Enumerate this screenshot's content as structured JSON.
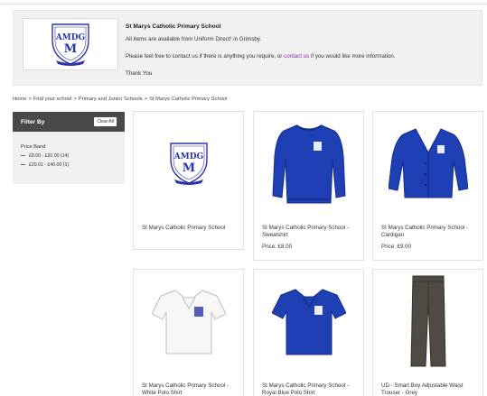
{
  "banner": {
    "title": "St Marys Catholic Primary School",
    "line1": "All items are available from Uniform Direct¹ in Grimsby.",
    "line2_pre": "Please feel free to contact us if there is anything you require, or",
    "line2_link": "contact us",
    "line2_post": "if you would like more information.",
    "thanks": "Thank You"
  },
  "breadcrumb": {
    "items": [
      "Home",
      "Find your school",
      "Primary and Junior Schools",
      "St Marys Catholic Primary School"
    ],
    "separator": ">"
  },
  "filter": {
    "title": "Filter By",
    "clear_label": "Clear All",
    "group_label": "Price Band",
    "options": [
      "£8.00 - £20.00 (14)",
      "£20.01 - £40.00 (1)"
    ]
  },
  "logo": {
    "text": "AMDG",
    "initial": "M"
  },
  "products": [
    {
      "name": "St Marys Catholic Primary School",
      "price": "",
      "image": "school-crest"
    },
    {
      "name": "St Marys Catholic Primary School - Sweatshirt",
      "price": "Price: £8.00",
      "image": "sweatshirt"
    },
    {
      "name": "St Marys Catholic Primary School - Cardigan",
      "price": "Price: £9.00",
      "image": "cardigan"
    },
    {
      "name": "St Marys Catholic Primary School - White Polo Shirt",
      "price": "",
      "image": "white-polo"
    },
    {
      "name": "St Marys Catholic Primary School - Royal Blue Polo Shirt",
      "price": "",
      "image": "blue-polo"
    },
    {
      "name": "UD - Smart Boy Adjustable Waist Trouser - Grey",
      "price": "",
      "image": "grey-trousers"
    }
  ],
  "colors": {
    "royal_blue": "#1f3fb4",
    "crest_blue": "#2b35a8",
    "link_purple": "#8a2ea6",
    "filter_header": "#4a4a4a",
    "trouser_grey": "#4f4a43"
  }
}
